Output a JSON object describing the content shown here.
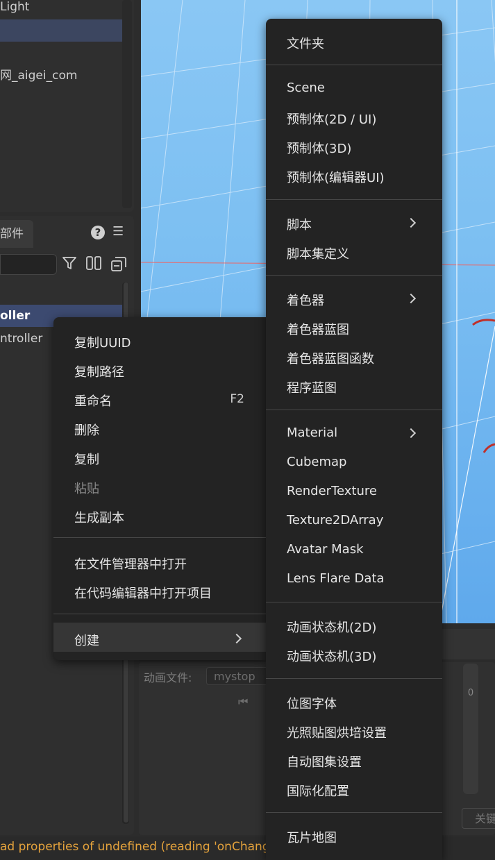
{
  "hierarchy": {
    "rows": [
      "Light",
      "",
      "",
      "网_aigei_com"
    ]
  },
  "assets": {
    "tab_label": "部件",
    "help_glyph": "?",
    "menu_glyph": "☰",
    "rows": [
      "oller",
      "ntroller"
    ]
  },
  "context_menu": {
    "items": [
      {
        "label": "复制UUID"
      },
      {
        "label": "复制路径"
      },
      {
        "label": "重命名",
        "shortcut": "F2"
      },
      {
        "label": "删除"
      },
      {
        "label": "复制"
      },
      {
        "label": "粘贴",
        "disabled": true
      },
      {
        "label": "生成副本"
      },
      {
        "label": "在文件管理器中打开"
      },
      {
        "label": "在代码编辑器中打开项目"
      },
      {
        "label": "创建",
        "submenu": true
      }
    ]
  },
  "create_menu": {
    "items": [
      {
        "label": "文件夹"
      },
      {
        "label": "Scene"
      },
      {
        "label": "预制体(2D / UI)"
      },
      {
        "label": "预制体(3D)"
      },
      {
        "label": "预制体(编辑器UI)"
      },
      {
        "label": "脚本",
        "submenu": true
      },
      {
        "label": "脚本集定义"
      },
      {
        "label": "着色器",
        "submenu": true
      },
      {
        "label": "着色器蓝图"
      },
      {
        "label": "着色器蓝图函数"
      },
      {
        "label": "程序蓝图"
      },
      {
        "label": "Material",
        "submenu": true
      },
      {
        "label": "Cubemap"
      },
      {
        "label": "RenderTexture"
      },
      {
        "label": "Texture2DArray"
      },
      {
        "label": "Avatar Mask"
      },
      {
        "label": "Lens Flare Data"
      },
      {
        "label": "动画状态机(2D)"
      },
      {
        "label": "动画状态机(3D)"
      },
      {
        "label": "位图字体"
      },
      {
        "label": "光照贴图烘培设置"
      },
      {
        "label": "自动图集设置"
      },
      {
        "label": "国际化配置"
      },
      {
        "label": "瓦片地图"
      }
    ]
  },
  "animation": {
    "file_label": "动画文件:",
    "file_value": "mystop",
    "rewind_glyph": "⏮",
    "slider_value": "0",
    "close_label": "关键"
  },
  "status": {
    "text": "ad properties of undefined (reading 'onChangeE"
  },
  "colors": {
    "menu_bg": "#232323",
    "selection": "#3c4a70",
    "status_warning": "#e5a33c",
    "scene_sky": "#7cbff2"
  }
}
